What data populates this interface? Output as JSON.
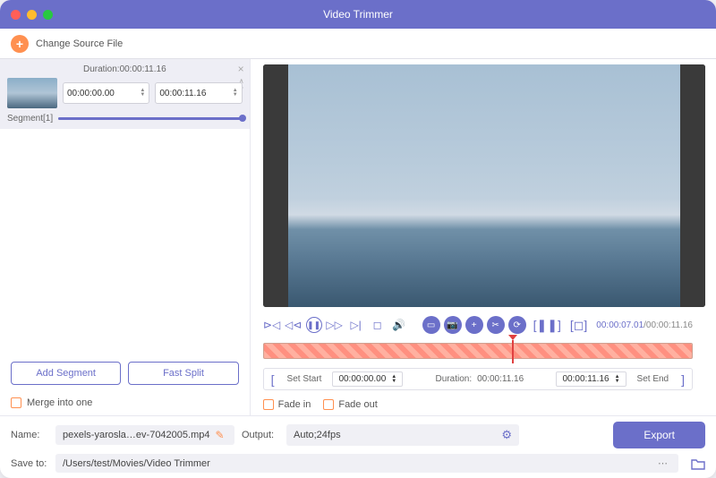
{
  "app": {
    "title": "Video Trimmer"
  },
  "toolbar": {
    "change_source": "Change Source File"
  },
  "segments": [
    {
      "name": "Segment[1]",
      "duration_label": "Duration:",
      "duration": "00:00:11.16",
      "start": "00:00:00.00",
      "end": "00:00:11.16"
    }
  ],
  "buttons": {
    "add_segment": "Add Segment",
    "fast_split": "Fast Split",
    "export": "Export"
  },
  "options": {
    "merge_label": "Merge into one",
    "fade_in": "Fade in",
    "fade_out": "Fade out"
  },
  "playback": {
    "current": "00:00:07.01",
    "total": "00:00:11.16"
  },
  "trim": {
    "set_start": "Set Start",
    "start": "00:00:00.00",
    "duration_label": "Duration:",
    "duration": "00:00:11.16",
    "end": "00:00:11.16",
    "set_end": "Set End"
  },
  "output": {
    "name_label": "Name:",
    "filename": "pexels-yarosla…ev-7042005.mp4",
    "output_label": "Output:",
    "format": "Auto;24fps",
    "save_to_label": "Save to:",
    "save_path": "/Users/test/Movies/Video Trimmer"
  }
}
